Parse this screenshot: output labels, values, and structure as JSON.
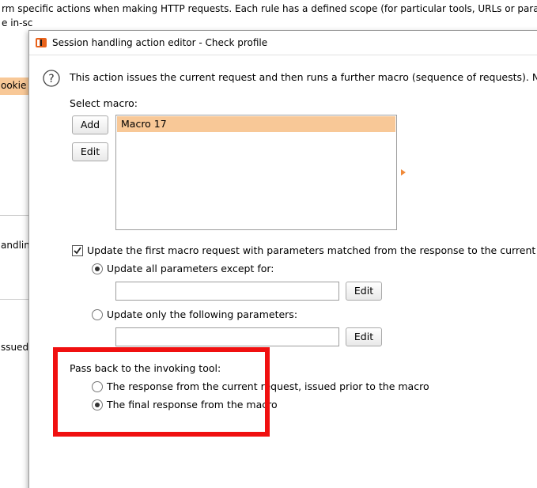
{
  "background": {
    "line1": "rm specific actions when making HTTP requests. Each rule has a defined scope (for particular tools, URLs or paramet",
    "line2": "e in-sc",
    "left_items": [
      "ookie",
      "andling",
      "ssued"
    ]
  },
  "dialog": {
    "title": "Session handling action editor - Check profile",
    "description": "This action issues the current request and then runs a further macro (sequence of requests). No furthe",
    "select_macro_label": "Select macro:",
    "add_label": "Add",
    "edit_label": "Edit",
    "macros": [
      "Macro 17"
    ],
    "update_first_label": "Update the first macro request with parameters matched from the response to the current request",
    "update_first_checked": true,
    "update_all_label": "Update all parameters except for:",
    "update_all_value": "",
    "update_all_edit": "Edit",
    "update_only_label": "Update only the following parameters:",
    "update_only_value": "",
    "update_only_edit": "Edit",
    "pass_back_label": "Pass back to the invoking tool:",
    "pass_back_option1": "The response from the current request, issued prior to the macro",
    "pass_back_option2": "The final response from the macro"
  },
  "colors": {
    "selection": "#f8c897",
    "accent": "#f08a3a",
    "highlight_box": "#f01010"
  }
}
